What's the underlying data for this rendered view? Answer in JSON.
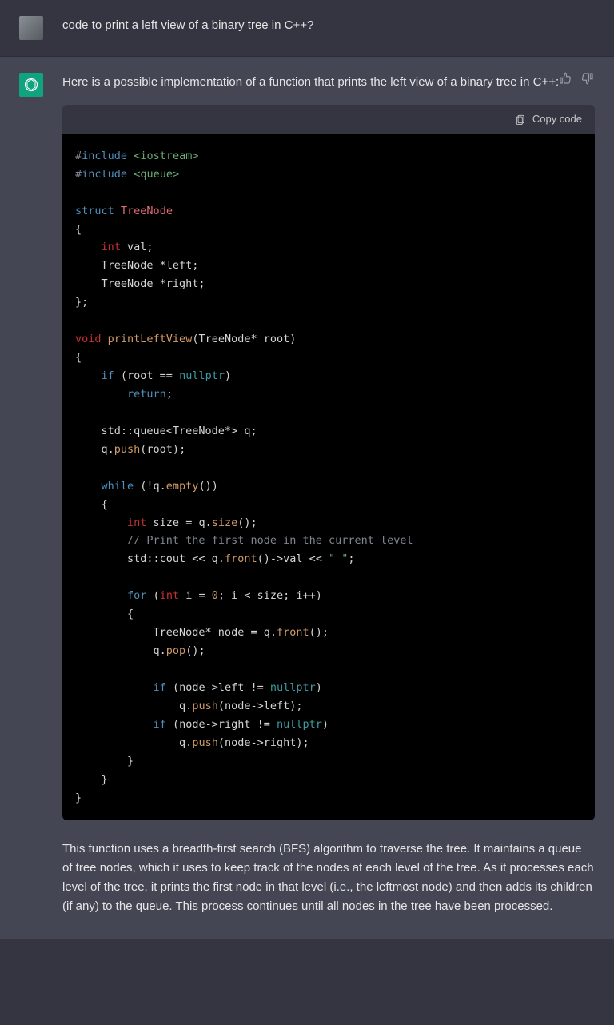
{
  "user": {
    "prompt": "code to print a left view of a binary tree in C++?"
  },
  "assistant": {
    "intro": "Here is a possible implementation of a function that prints the left view of a binary tree in C++:",
    "explanation": "This function uses a breadth-first search (BFS) algorithm to traverse the tree. It maintains a queue of tree nodes, which it uses to keep track of the nodes at each level of the tree. As it processes each level of the tree, it prints the first node in that level (i.e., the leftmost node) and then adds its children (if any) to the queue. This process continues until all nodes in the tree have been processed."
  },
  "codeblock": {
    "copy_label": "Copy code"
  },
  "code": {
    "hash": "#",
    "include": "include",
    "iostream": "<iostream>",
    "queue_hdr": "<queue>",
    "struct": "struct",
    "TreeNode": "TreeNode",
    "lbrace": "{",
    "rbrace": "}",
    "rbrace_semi": "};",
    "int": "int",
    "val_decl": " val;",
    "left_decl": "    TreeNode *left;",
    "right_decl": "    TreeNode *right;",
    "void": "void",
    "printLeftView": "printLeftView",
    "sig_rest": "(TreeNode* root)",
    "if": "if",
    "root_eq": " (root == ",
    "nullptr": "nullptr",
    "close_paren": ")",
    "return": "return",
    "semicolon": ";",
    "queue_decl": "    std::queue<TreeNode*> q;",
    "q_dot": "    q.",
    "push": "push",
    "push_root": "(root);",
    "while": "while",
    "not_q": " (!q.",
    "empty": "empty",
    "empty_rest": "())",
    "size_lhs": " size = q.",
    "size_fn": "size",
    "size_rest": "();",
    "comment": "// Print the first node in the current level",
    "cout_pre": "        std::cout << q.",
    "front": "front",
    "cout_mid": "()->val << ",
    "space_str": "\" \"",
    "for": "for",
    "for_open": " (",
    "i_eq": " i = ",
    "zero": "0",
    "for_rest": "; i < size; i++)",
    "node_decl_pre": "            TreeNode* node = q.",
    "front_call": "();",
    "pop_pre": "            q.",
    "pop": "pop",
    "pop_rest": "();",
    "if_left_pre": " (node->left != ",
    "push_left_pre": "                q.",
    "push_left_arg": "(node->left);",
    "if_right_pre": " (node->right != ",
    "push_right_arg": "(node->right);",
    "ind4": "    ",
    "ind8": "        ",
    "ind12": "            "
  }
}
